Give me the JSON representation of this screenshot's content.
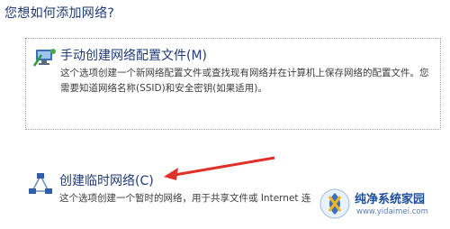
{
  "heading": "您想如何添加网络?",
  "options": [
    {
      "title": "手动创建网络配置文件(M)",
      "description": "这个选项创建一个新网络配置文件或查找现有网络并在计算机上保存网络的配置文件。您需要知道网络名称(SSID)和安全密钥(如果适用)。",
      "icon": "wireless-network-icon",
      "selected": true
    },
    {
      "title": "创建临时网络(C)",
      "description": "这个选项创建一个暂时的网络，用于共享文件或 Internet 连",
      "icon": "adhoc-network-icon",
      "selected": false
    }
  ],
  "watermark": {
    "title": "纯净系统家园",
    "url": "www.yidaimei.com"
  },
  "colors": {
    "heading": "#1e3a78",
    "arrow": "#e0302a",
    "watermark": "#1f4f9c"
  }
}
